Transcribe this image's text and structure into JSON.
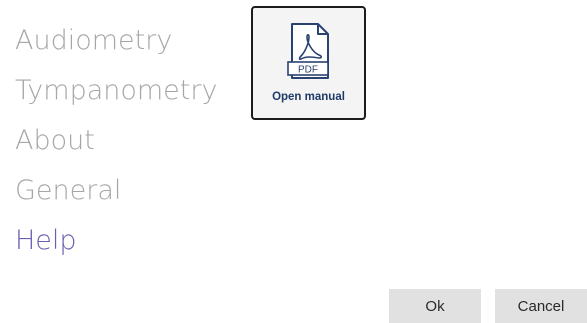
{
  "nav": {
    "items": [
      {
        "label": "Audiometry"
      },
      {
        "label": "Tympanometry"
      },
      {
        "label": "About"
      },
      {
        "label": "General"
      },
      {
        "label": "Help"
      }
    ],
    "active": "Help"
  },
  "manual": {
    "icon": "pdf-file-icon",
    "icon_text": "PDF",
    "label": "Open manual"
  },
  "buttons": {
    "ok_label": "Ok",
    "cancel_label": "Cancel"
  },
  "colors": {
    "nav_inactive": "#a6a6a6",
    "nav_active": "#6a5fb0",
    "manual_label": "#1f3a66",
    "button_bg": "#e1e1e1"
  }
}
